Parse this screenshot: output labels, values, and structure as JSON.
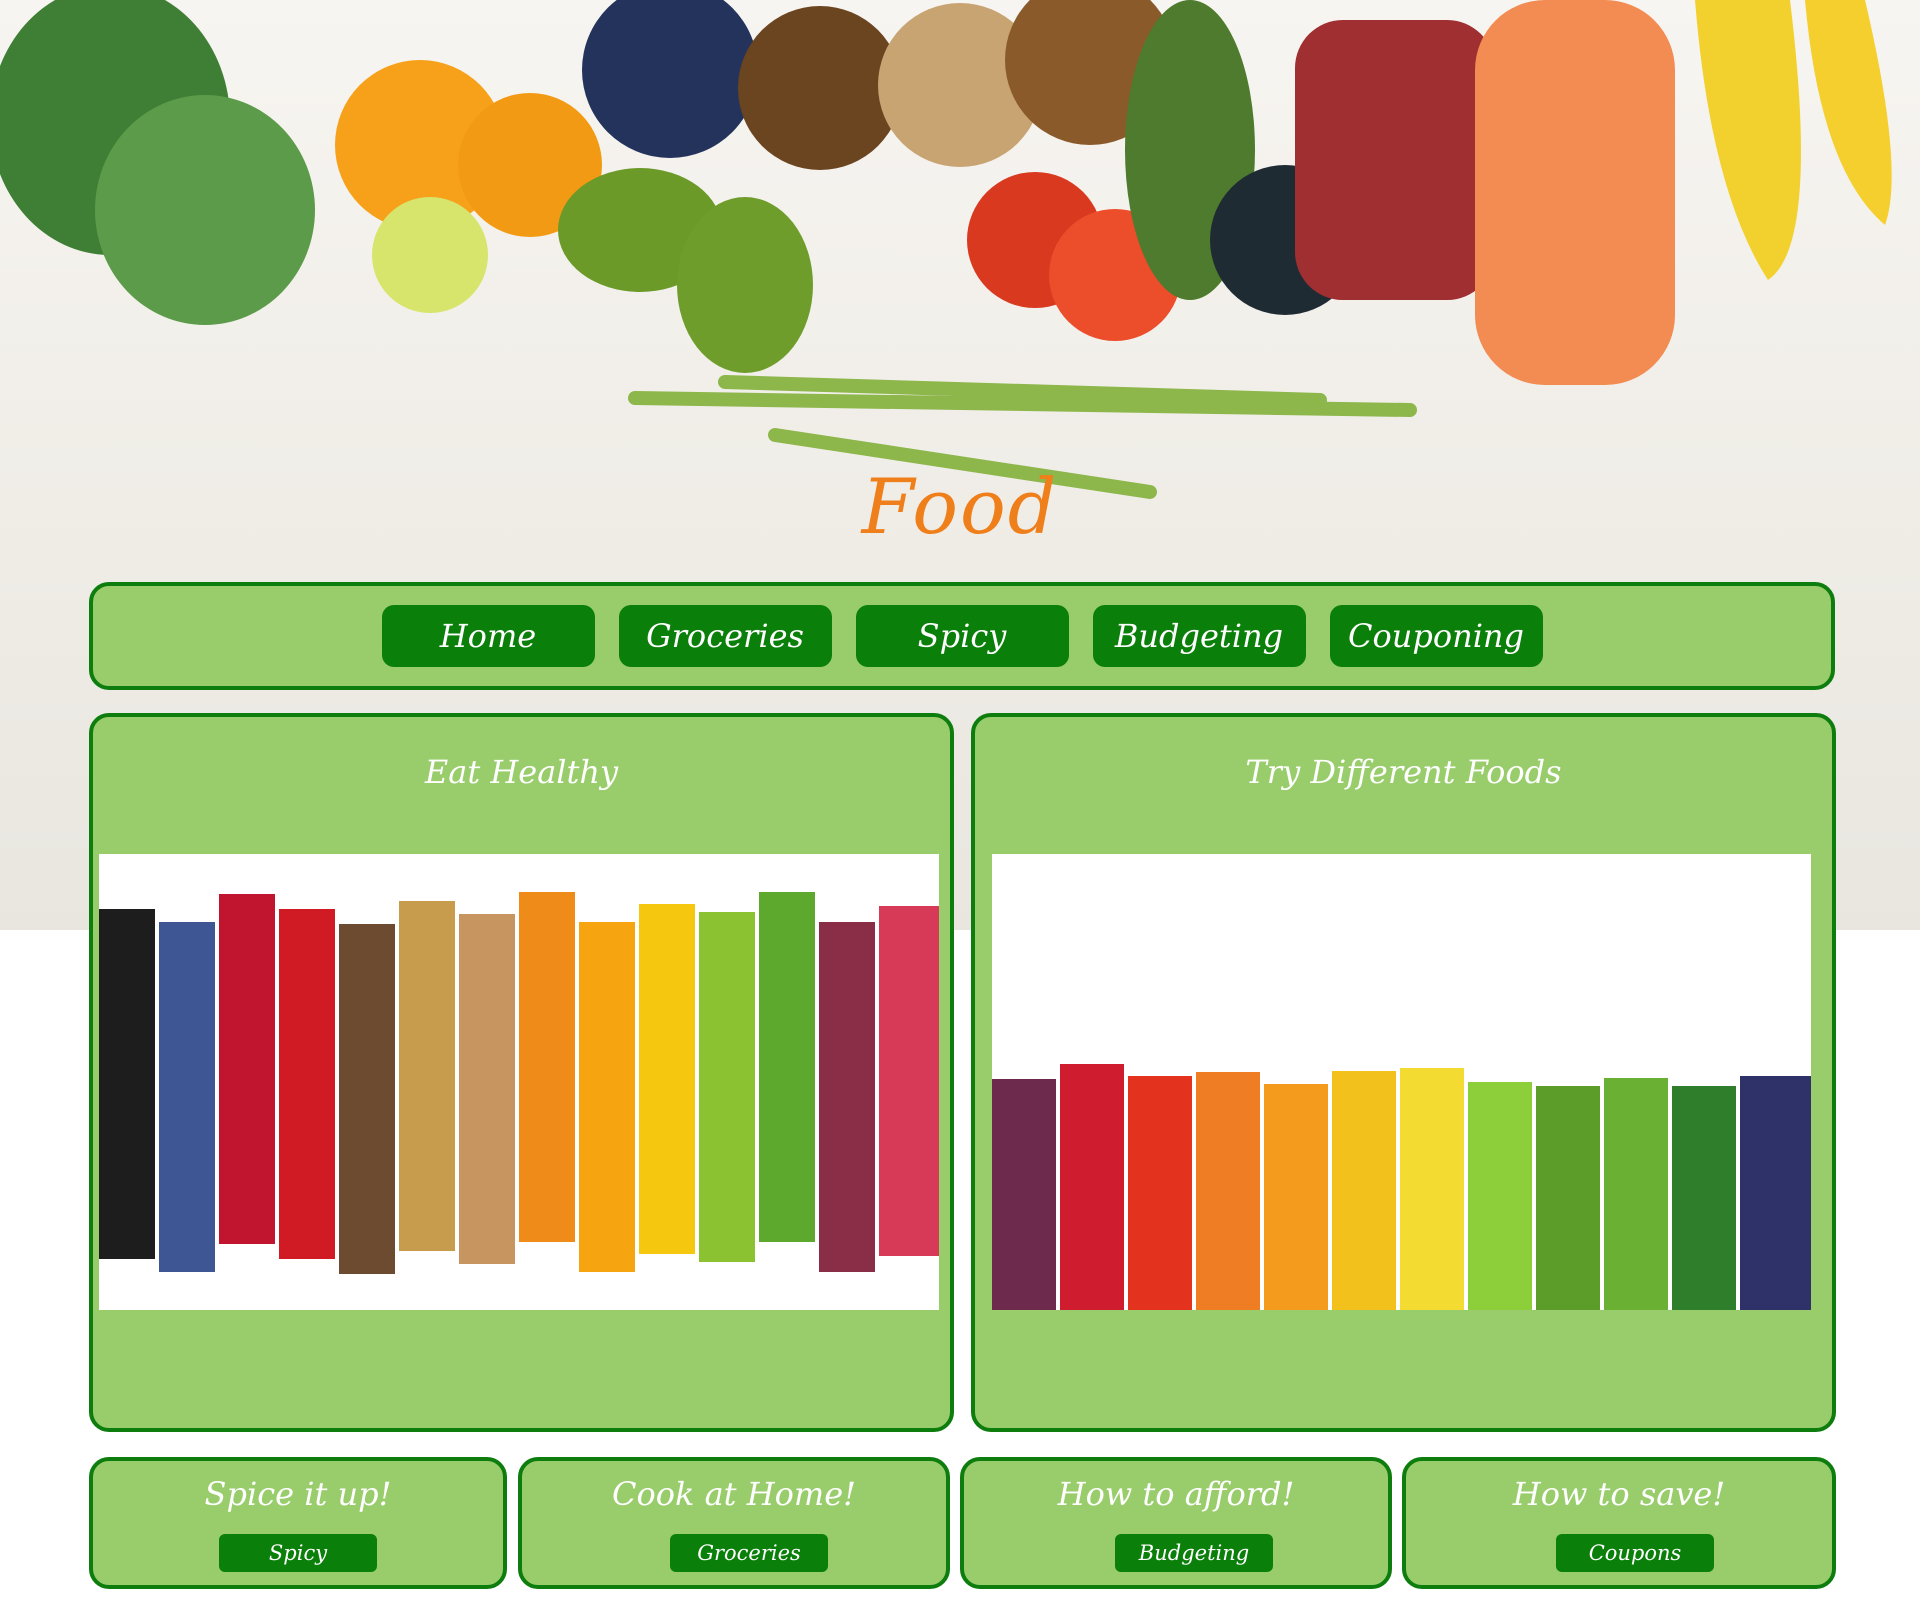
{
  "site": {
    "title": "Food"
  },
  "nav": {
    "items": [
      {
        "label": "Home"
      },
      {
        "label": "Groceries"
      },
      {
        "label": "Spicy"
      },
      {
        "label": "Budgeting"
      },
      {
        "label": "Couponing"
      }
    ]
  },
  "panels": [
    {
      "title": "Eat Healthy"
    },
    {
      "title": "Try Different Foods"
    }
  ],
  "cards": [
    {
      "title": "Spice it up!",
      "button": "Spicy"
    },
    {
      "title": "Cook at Home!",
      "button": "Groceries"
    },
    {
      "title": "How to afford!",
      "button": "Budgeting"
    },
    {
      "title": "How to save!",
      "button": "Coupons"
    }
  ],
  "colors": {
    "title_orange": "#ef7f1a",
    "panel_green": "#99cd6c",
    "button_green": "#0a7f0a",
    "border_green": "#0d7d0d"
  }
}
